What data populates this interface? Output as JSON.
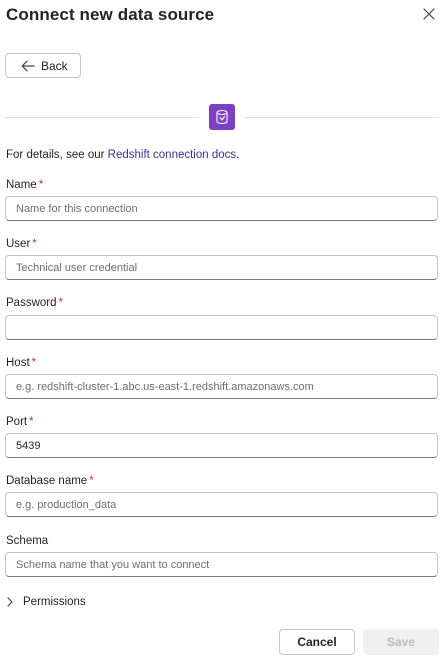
{
  "dialog": {
    "title": "Connect new data source",
    "close_icon": "close-icon"
  },
  "back_button": {
    "label": "Back",
    "icon": "arrow-left-icon"
  },
  "source_icon": {
    "name": "redshift-icon",
    "color": "#7b40c4"
  },
  "details": {
    "prefix": "For details, see our ",
    "link_text": "Redshift connection docs",
    "suffix": "."
  },
  "required_marker": "*",
  "fields": {
    "name": {
      "label": "Name",
      "required": true,
      "value": "",
      "placeholder": "Name for this connection"
    },
    "user": {
      "label": "User",
      "required": true,
      "value": "",
      "placeholder": "Technical user credential"
    },
    "password": {
      "label": "Password",
      "required": true,
      "value": "",
      "placeholder": ""
    },
    "host": {
      "label": "Host",
      "required": true,
      "value": "",
      "placeholder": "e.g. redshift-cluster-1.abc.us-east-1.redshift.amazonaws.com"
    },
    "port": {
      "label": "Port",
      "required": true,
      "value": "5439",
      "placeholder": ""
    },
    "database": {
      "label": "Database name",
      "required": true,
      "value": "",
      "placeholder": "e.g. production_data"
    },
    "schema": {
      "label": "Schema",
      "required": false,
      "value": "",
      "placeholder": "Schema name that you want to connect"
    }
  },
  "permissions": {
    "label": "Permissions",
    "icon": "chevron-right-icon",
    "expanded": false
  },
  "footer": {
    "cancel_label": "Cancel",
    "save_label": "Save",
    "save_enabled": false
  }
}
